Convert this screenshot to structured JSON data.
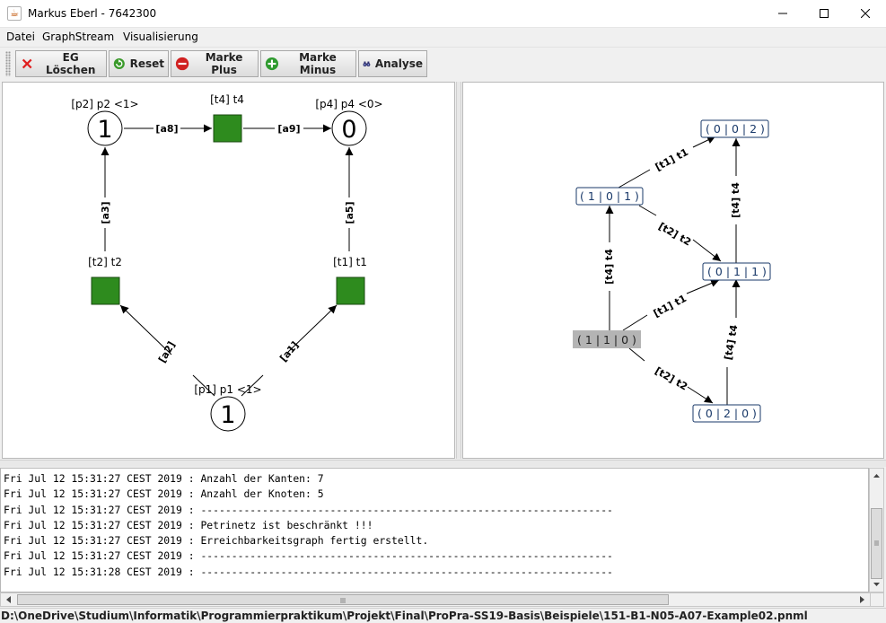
{
  "window": {
    "title": "Markus Eberl - 7642300"
  },
  "menubar": {
    "items": [
      "Datei",
      "GraphStream",
      "Visualisierung"
    ]
  },
  "toolbar": {
    "buttons": [
      {
        "label": "EG Löschen",
        "icon": "close-x-icon",
        "color": "#e02020"
      },
      {
        "label": "Reset",
        "icon": "refresh-icon",
        "color": "#3a9a2a"
      },
      {
        "label": "Marke Plus",
        "icon": "minus-circle-icon",
        "color": "#d02020"
      },
      {
        "label": "Marke Minus",
        "icon": "plus-circle-icon",
        "color": "#2e9a2e"
      },
      {
        "label": "Analyse",
        "icon": "binoculars-icon",
        "color": "#303070"
      }
    ]
  },
  "petri_net": {
    "places": [
      {
        "id": "p2",
        "label": "[p2] p2 <1>",
        "tokens": "1"
      },
      {
        "id": "p4",
        "label": "[p4] p4 <0>",
        "tokens": "0"
      },
      {
        "id": "p1",
        "label": "[p1] p1 <1>",
        "tokens": "1"
      }
    ],
    "transitions": [
      {
        "id": "t4",
        "label": "[t4] t4",
        "color": "#2e8b1e"
      },
      {
        "id": "t2",
        "label": "[t2] t2",
        "color": "#2e8b1e"
      },
      {
        "id": "t1",
        "label": "[t1] t1",
        "color": "#2e8b1e"
      }
    ],
    "arcs": [
      {
        "id": "a8",
        "label": "[a8]"
      },
      {
        "id": "a9",
        "label": "[a9]"
      },
      {
        "id": "a3",
        "label": "[a3]"
      },
      {
        "id": "a5",
        "label": "[a5]"
      },
      {
        "id": "a2",
        "label": "[a2]"
      },
      {
        "id": "a1",
        "label": "[a1]"
      }
    ]
  },
  "reachability_graph": {
    "nodes": [
      {
        "id": "n002",
        "label": "( 0 | 0 | 2 )",
        "highlighted": false
      },
      {
        "id": "n101",
        "label": "( 1 | 0 | 1 )",
        "highlighted": false
      },
      {
        "id": "n011",
        "label": "( 0 | 1 | 1 )",
        "highlighted": false
      },
      {
        "id": "n110",
        "label": "( 1 | 1 | 0 )",
        "highlighted": true
      },
      {
        "id": "n020",
        "label": "( 0 | 2 | 0 )",
        "highlighted": false
      }
    ],
    "edges": [
      {
        "label": "[t1] t1"
      },
      {
        "label": "[t4] t4"
      },
      {
        "label": "[t2] t2"
      },
      {
        "label": "[t4] t4"
      },
      {
        "label": "[t1] t1"
      },
      {
        "label": "[t4] t4"
      },
      {
        "label": "[t2] t2"
      }
    ],
    "node_color": "#1a3a6a",
    "highlight_color": "#b4b4b4"
  },
  "console": {
    "lines": [
      "Fri Jul 12 15:31:27 CEST 2019 : Anzahl der Kanten: 7",
      "Fri Jul 12 15:31:27 CEST 2019 : Anzahl der Knoten: 5",
      "Fri Jul 12 15:31:27 CEST 2019 : -------------------------------------------------------------------",
      "Fri Jul 12 15:31:27 CEST 2019 : Petrinetz ist beschränkt !!!",
      "Fri Jul 12 15:31:27 CEST 2019 : Erreichbarkeitsgraph fertig erstellt.",
      "Fri Jul 12 15:31:27 CEST 2019 : -------------------------------------------------------------------",
      "Fri Jul 12 15:31:28 CEST 2019 : -------------------------------------------------------------------"
    ]
  },
  "statusbar": {
    "path": "D:\\OneDrive\\Studium\\Informatik\\Programmierpraktikum\\Projekt\\Final\\ProPra-SS19-Basis\\Beispiele\\151-B1-N05-A07-Example02.pnml"
  }
}
